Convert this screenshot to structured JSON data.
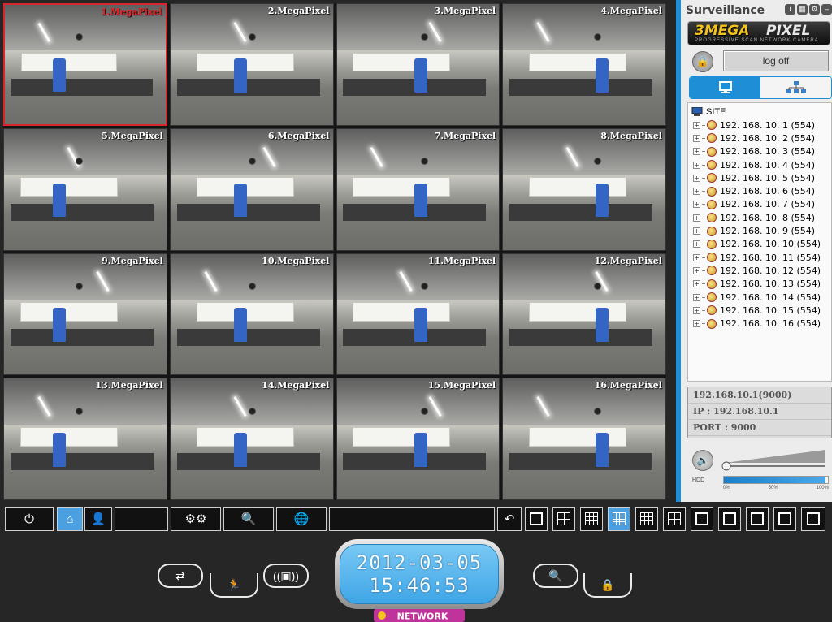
{
  "cameras": [
    {
      "label": "1.MegaPixel",
      "selected": true
    },
    {
      "label": "2.MegaPixel",
      "selected": false
    },
    {
      "label": "3.MegaPixel",
      "selected": false
    },
    {
      "label": "4.MegaPixel",
      "selected": false
    },
    {
      "label": "5.MegaPixel",
      "selected": false
    },
    {
      "label": "6.MegaPixel",
      "selected": false
    },
    {
      "label": "7.MegaPixel",
      "selected": false
    },
    {
      "label": "8.MegaPixel",
      "selected": false
    },
    {
      "label": "9.MegaPixel",
      "selected": false
    },
    {
      "label": "10.MegaPixel",
      "selected": false
    },
    {
      "label": "11.MegaPixel",
      "selected": false
    },
    {
      "label": "12.MegaPixel",
      "selected": false
    },
    {
      "label": "13.MegaPixel",
      "selected": false
    },
    {
      "label": "14.MegaPixel",
      "selected": false
    },
    {
      "label": "15.MegaPixel",
      "selected": false
    },
    {
      "label": "16.MegaPixel",
      "selected": false
    }
  ],
  "panel": {
    "title": "Surveillance",
    "logo_primary": "3MEGA",
    "logo_secondary": "PIXEL",
    "logo_tagline": "PROGRESSIVE SCAN  NETWORK CAMERA",
    "logoff_label": "log off",
    "tree_root": "SITE",
    "tree_items": [
      "192. 168. 10. 1 (554)",
      "192. 168. 10. 2 (554)",
      "192. 168. 10. 3 (554)",
      "192. 168. 10. 4 (554)",
      "192. 168. 10. 5 (554)",
      "192. 168. 10. 6 (554)",
      "192. 168. 10. 7 (554)",
      "192. 168. 10. 8 (554)",
      "192. 168. 10. 9 (554)",
      "192. 168. 10. 10 (554)",
      "192. 168. 10. 11 (554)",
      "192. 168. 10. 12 (554)",
      "192. 168. 10. 13 (554)",
      "192. 168. 10. 14 (554)",
      "192. 168. 10. 15 (554)",
      "192. 168. 10. 16 (554)"
    ],
    "info": {
      "connection": "192.168.10.1(9000)",
      "ip": "IP : 192.168.10.1",
      "port": "PORT : 9000"
    },
    "volume_level": 0.0,
    "hdd_label": "HDD",
    "hdd_fill": 0.98,
    "hdd_ticks": [
      "0%",
      "50%",
      "100%"
    ]
  },
  "datetime": {
    "date": "2012-03-05",
    "time": "15:46:53"
  },
  "network_badge": "NETWORK",
  "icons": {
    "power": "power-icon",
    "home": "home-icon",
    "user": "user-icon",
    "settings": "gear-icon",
    "search": "search-icon",
    "globe": "globe-icon",
    "undo": "undo-icon"
  },
  "colors": {
    "accent": "#1e8fd6",
    "selected_border": "#d9262e",
    "clock_face": "#4aaeea"
  }
}
